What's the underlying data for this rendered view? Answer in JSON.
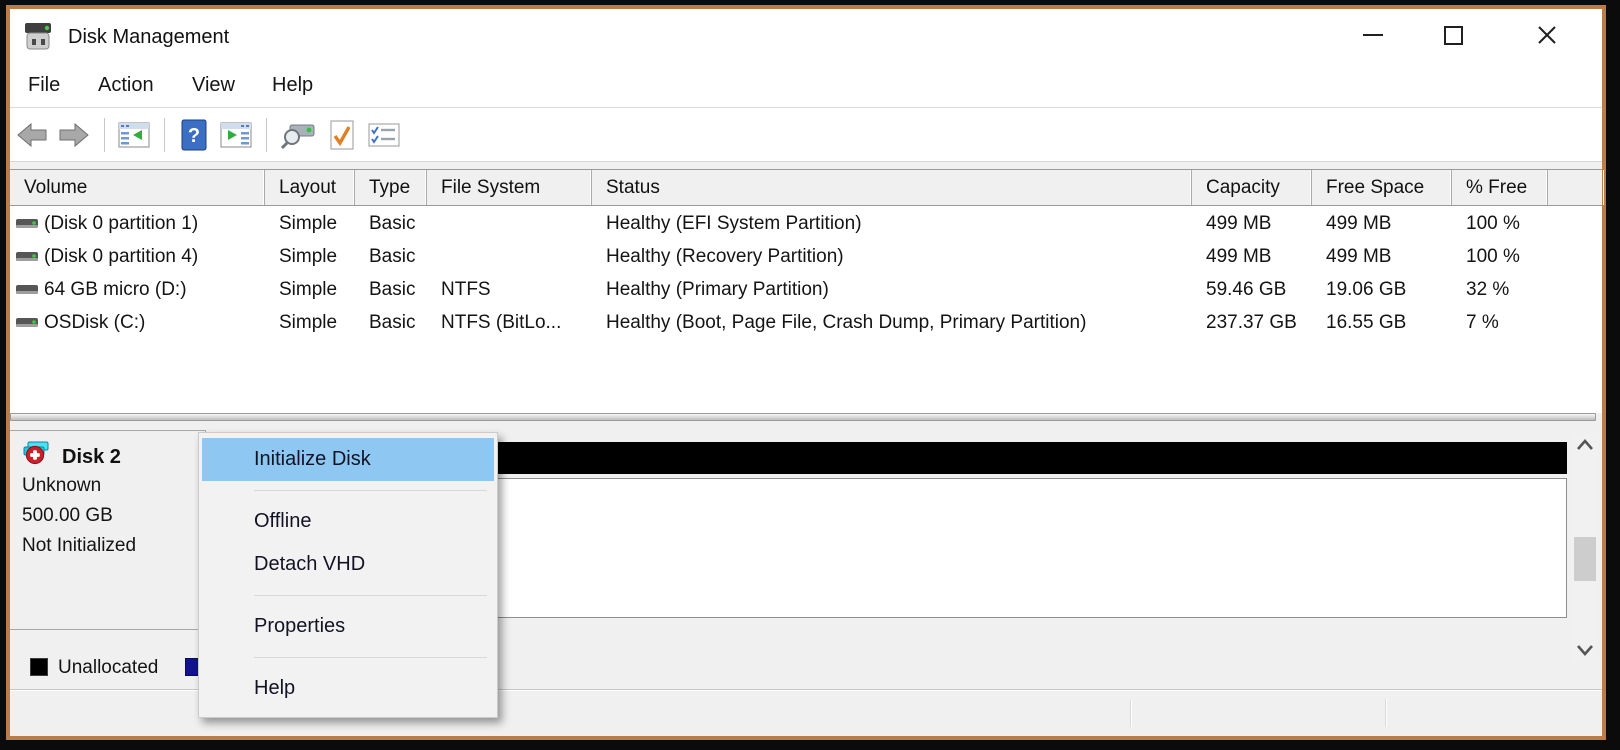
{
  "title_bar": {
    "title": "Disk Management"
  },
  "menu_bar": {
    "items": [
      "File",
      "Action",
      "View",
      "Help"
    ]
  },
  "toolbar": {
    "icons": [
      "back",
      "forward",
      "show-console-tree",
      "help",
      "show-action-pane",
      "rescan-disks",
      "check-document",
      "task-list"
    ]
  },
  "volume_table": {
    "columns": [
      "Volume",
      "Layout",
      "Type",
      "File System",
      "Status",
      "Capacity",
      "Free Space",
      "% Free"
    ],
    "rows": [
      {
        "volume": "(Disk 0 partition 1)",
        "layout": "Simple",
        "type": "Basic",
        "file_system": "",
        "status": "Healthy (EFI System Partition)",
        "capacity": "499 MB",
        "free_space": "499 MB",
        "pct_free": "100 %"
      },
      {
        "volume": "(Disk 0 partition 4)",
        "layout": "Simple",
        "type": "Basic",
        "file_system": "",
        "status": "Healthy (Recovery Partition)",
        "capacity": "499 MB",
        "free_space": "499 MB",
        "pct_free": "100 %"
      },
      {
        "volume": "64 GB micro (D:)",
        "layout": "Simple",
        "type": "Basic",
        "file_system": "NTFS",
        "status": "Healthy (Primary Partition)",
        "capacity": "59.46 GB",
        "free_space": "19.06 GB",
        "pct_free": "32 %"
      },
      {
        "volume": "OSDisk (C:)",
        "layout": "Simple",
        "type": "Basic",
        "file_system": "NTFS (BitLo...",
        "status": "Healthy (Boot, Page File, Crash Dump, Primary Partition)",
        "capacity": "237.37 GB",
        "free_space": "16.55 GB",
        "pct_free": "7 %"
      }
    ]
  },
  "disk_pane": {
    "disk": {
      "name": "Disk 2",
      "type": "Unknown",
      "size": "500.00 GB",
      "status": "Not Initialized"
    }
  },
  "context_menu": {
    "items": [
      {
        "label": "Initialize Disk"
      },
      {
        "label": "Offline"
      },
      {
        "label": "Detach VHD"
      },
      {
        "label": "Properties"
      },
      {
        "label": "Help"
      }
    ]
  },
  "legend": {
    "items": [
      {
        "label": "Unallocated",
        "color": "#000000"
      },
      {
        "label": "",
        "color": "#12128e"
      }
    ]
  },
  "colors": {
    "menu_highlight": "#8ec8f2",
    "window_border": "#ba7c48",
    "unallocated_bar": "#000000",
    "titlebar_bg": "#ffffff"
  }
}
